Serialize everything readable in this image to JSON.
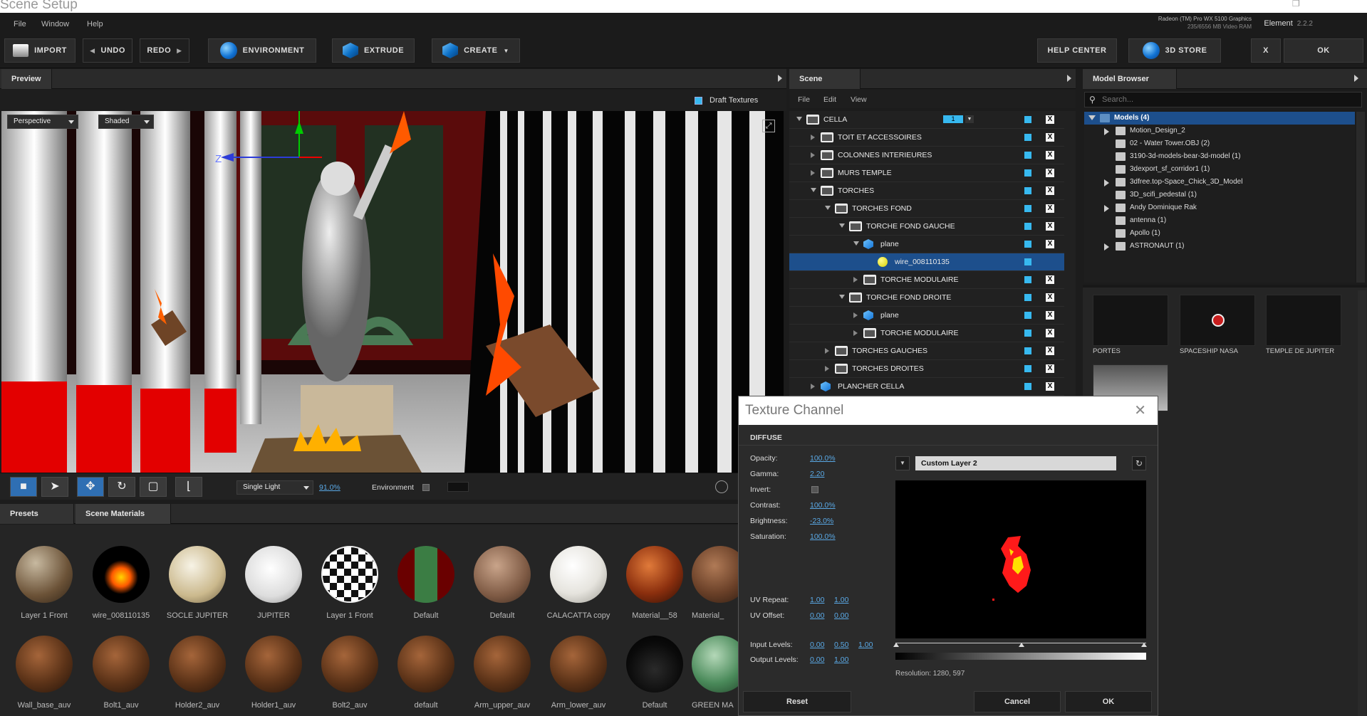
{
  "app": {
    "title": "Scene Setup",
    "menu": [
      "File",
      "Window",
      "Help"
    ],
    "gpu_name": "Radeon (TM) Pro WX 5100 Graphics",
    "gpu_ram": "235/6556 MB Video RAM",
    "product": "Element",
    "version": "2.2.2"
  },
  "toolbar": {
    "import": "IMPORT",
    "undo": "UNDO",
    "redo": "REDO",
    "environment": "ENVIRONMENT",
    "extrude": "EXTRUDE",
    "create": "CREATE",
    "help_center": "HELP CENTER",
    "store": "3D STORE",
    "close": "X",
    "ok": "OK"
  },
  "preview": {
    "tab": "Preview",
    "draft_textures": "Draft Textures",
    "camera": "Perspective",
    "shading": "Shaded",
    "light": "Single Light",
    "light_value": "91.0%",
    "environment": "Environment",
    "axis_z": "Z"
  },
  "materials": {
    "tabs": [
      "Presets",
      "Scene Materials"
    ],
    "row1": [
      "Layer 1 Front",
      "wire_008110135",
      "SOCLE JUPITER",
      "JUPITER",
      "Layer 1 Front",
      "Default",
      "Default",
      "CALACATTA copy",
      "Material__58",
      "Material_"
    ],
    "row2": [
      "Wall_base_auv",
      "Bolt1_auv",
      "Holder2_auv",
      "Holder1_auv",
      "Bolt2_auv",
      "default",
      "Arm_upper_auv",
      "Arm_lower_auv",
      "Default",
      "GREEN MA"
    ]
  },
  "scene": {
    "tab": "Scene",
    "menu": [
      "File",
      "Edit",
      "View"
    ],
    "layer_badge": "1",
    "tree": [
      {
        "label": "CELLA",
        "depth": 0,
        "icon": "folder",
        "open": true
      },
      {
        "label": "TOIT ET ACCESSOIRES",
        "depth": 1,
        "icon": "folder",
        "open": false
      },
      {
        "label": "COLONNES INTERIEURES",
        "depth": 1,
        "icon": "folder",
        "open": false
      },
      {
        "label": "MURS TEMPLE",
        "depth": 1,
        "icon": "folder",
        "open": false
      },
      {
        "label": "TORCHES",
        "depth": 1,
        "icon": "folder",
        "open": true
      },
      {
        "label": "TORCHES FOND",
        "depth": 2,
        "icon": "folder",
        "open": true
      },
      {
        "label": "TORCHE FOND GAUCHE",
        "depth": 3,
        "icon": "folder",
        "open": true
      },
      {
        "label": "plane",
        "depth": 4,
        "icon": "cube",
        "open": true
      },
      {
        "label": "wire_008110135",
        "depth": 5,
        "icon": "material",
        "open": null,
        "selected": true
      },
      {
        "label": "TORCHE MODULAIRE",
        "depth": 4,
        "icon": "folder",
        "open": false
      },
      {
        "label": "TORCHE FOND DROITE",
        "depth": 3,
        "icon": "folder",
        "open": true
      },
      {
        "label": "plane",
        "depth": 4,
        "icon": "cube",
        "open": false
      },
      {
        "label": "TORCHE MODULAIRE",
        "depth": 4,
        "icon": "folder",
        "open": false
      },
      {
        "label": "TORCHES GAUCHES",
        "depth": 2,
        "icon": "folder",
        "open": false
      },
      {
        "label": "TORCHES DROITES",
        "depth": 2,
        "icon": "folder",
        "open": false
      },
      {
        "label": "PLANCHER CELLA",
        "depth": 1,
        "icon": "cube",
        "open": false
      }
    ]
  },
  "model_browser": {
    "tab": "Model Browser",
    "search_placeholder": "Search...",
    "items": [
      {
        "label": "Models (4)",
        "depth": 0,
        "open": true,
        "selected": true
      },
      {
        "label": "Motion_Design_2",
        "depth": 1,
        "open": false
      },
      {
        "label": "02 - Water Tower.OBJ (2)",
        "depth": 1,
        "open": null
      },
      {
        "label": "3190-3d-models-bear-3d-model (1)",
        "depth": 1,
        "open": null
      },
      {
        "label": "3dexport_sf_corridor1 (1)",
        "depth": 1,
        "open": null
      },
      {
        "label": "3dfree.top-Space_Chick_3D_Model",
        "depth": 1,
        "open": false
      },
      {
        "label": "3D_scifi_pedestal (1)",
        "depth": 1,
        "open": null
      },
      {
        "label": "Andy Dominique Rak",
        "depth": 1,
        "open": false
      },
      {
        "label": "antenna (1)",
        "depth": 1,
        "open": null
      },
      {
        "label": "Apollo (1)",
        "depth": 1,
        "open": null
      },
      {
        "label": "ASTRONAUT (1)",
        "depth": 1,
        "open": false
      }
    ],
    "thumbs": [
      "PORTES",
      "SPACESHIP NASA",
      "TEMPLE DE JUPITER"
    ]
  },
  "texture_dialog": {
    "title": "Texture Channel",
    "section": "DIFFUSE",
    "opacity_label": "Opacity:",
    "opacity": "100.0%",
    "gamma_label": "Gamma:",
    "gamma": "2.20",
    "invert_label": "Invert:",
    "contrast_label": "Contrast:",
    "contrast": "100.0%",
    "brightness_label": "Brightness:",
    "brightness": "-23.0%",
    "saturation_label": "Saturation:",
    "saturation": "100.0%",
    "uv_repeat_label": "UV Repeat:",
    "uv_repeat_u": "1.00",
    "uv_repeat_v": "1.00",
    "uv_offset_label": "UV Offset:",
    "uv_offset_u": "0.00",
    "uv_offset_v": "0.00",
    "input_levels_label": "Input Levels:",
    "input_low": "0.00",
    "input_mid": "0.50",
    "input_high": "1.00",
    "output_levels_label": "Output Levels:",
    "output_low": "0.00",
    "output_high": "1.00",
    "layer": "Custom Layer 2",
    "resolution": "Resolution: 1280, 597",
    "reset": "Reset",
    "cancel": "Cancel",
    "ok": "OK"
  },
  "colors": {
    "accent": "#37b9f0",
    "selection": "#1d4f8c",
    "link": "#5aa9e6"
  }
}
